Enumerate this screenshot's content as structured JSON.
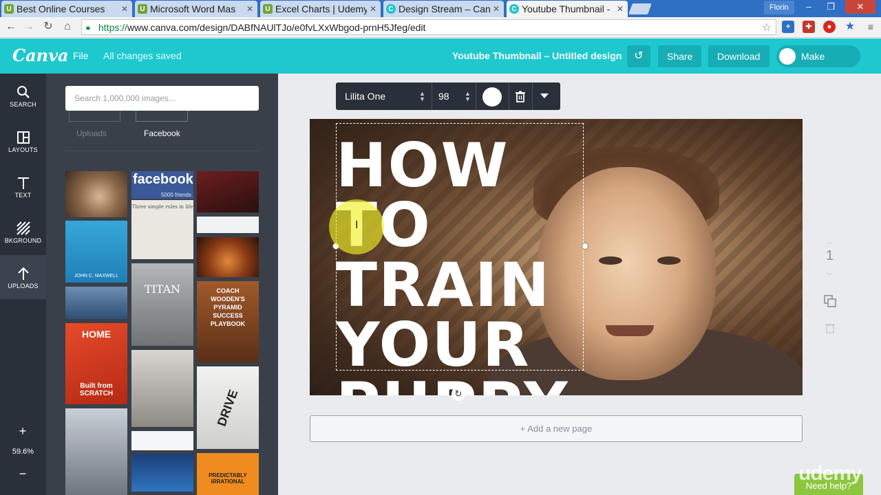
{
  "browser": {
    "tabs": [
      {
        "label": "Best Online Courses",
        "favicon": "udemy-icon"
      },
      {
        "label": "Microsoft Word Mas",
        "favicon": "udemy-icon"
      },
      {
        "label": "Excel Charts | Udemy",
        "favicon": "udemy-icon"
      },
      {
        "label": "Design Stream – Can",
        "favicon": "canva-icon"
      },
      {
        "label": "Youtube Thumbnail -",
        "favicon": "canva-icon",
        "active": true
      }
    ],
    "user_name": "Florin",
    "url_proto": "https://",
    "url_rest": "www.canva.com/design/DABfNAUlTJo/e0fvLXxWbgod-prnH5Jfeg/edit"
  },
  "header": {
    "logo": "Canva",
    "file_label": "File",
    "saved_status": "All changes saved",
    "doc_title": "Youtube Thumbnail – Untitled design",
    "share_label": "Share",
    "download_label": "Download",
    "public_label": "Make public"
  },
  "sidebar": {
    "items": [
      {
        "label": "SEARCH",
        "icon": "search-icon"
      },
      {
        "label": "LAYOUTS",
        "icon": "layouts-icon"
      },
      {
        "label": "TEXT",
        "icon": "text-icon"
      },
      {
        "label": "BKGROUND",
        "icon": "background-icon"
      },
      {
        "label": "UPLOADS",
        "icon": "upload-icon",
        "active": true
      }
    ],
    "zoom": "59.6%"
  },
  "panel": {
    "search_placeholder": "Search 1,000,000 images...",
    "subtabs": [
      "Uploads",
      "Facebook"
    ],
    "active_subtab": "Facebook",
    "thumb_texts": {
      "facebook": "facebook",
      "friends": "5000 friends",
      "rules": "Three simple rules in life",
      "maxwell": "JOHN C. MAXWELL",
      "titan": "TITAN",
      "coach": "COACH WOODEN'S PYRAMID SUCCESS PLAYBOOK",
      "home": "HOME",
      "scratch": "Built from SCRATCH",
      "drive": "DRIVE",
      "predictably": "PREDICTABLY IRRATIONAL"
    }
  },
  "textbar": {
    "font": "Lilita One",
    "size": "98"
  },
  "design": {
    "headline": "HOW TO\nTRAIN\nYOUR\nPUPPY"
  },
  "pages": {
    "current": "1",
    "add_page_label": "+ Add a new page"
  },
  "help": {
    "label": "Need help?",
    "watermark": "udemy"
  },
  "colors": {
    "canva_teal": "#1ec8cf",
    "sidebar_dark": "#293039",
    "panel_dark": "#3a4049",
    "help_green": "#8cc63f"
  }
}
